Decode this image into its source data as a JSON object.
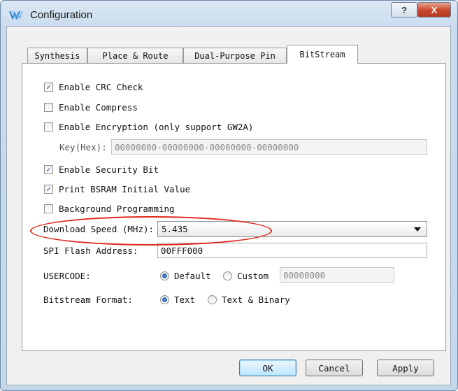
{
  "window": {
    "title": "Configuration",
    "help_label": "?",
    "close_label": "X"
  },
  "tabs": [
    {
      "label": "Synthesis",
      "active": false
    },
    {
      "label": "Place & Route",
      "active": false
    },
    {
      "label": "Dual-Purpose Pin",
      "active": false
    },
    {
      "label": "BitStream",
      "active": true
    }
  ],
  "options": {
    "crc": {
      "label": "Enable CRC Check",
      "checked": true
    },
    "compress": {
      "label": "Enable Compress",
      "checked": false
    },
    "encryption": {
      "label": "Enable Encryption (only support GW2A)",
      "checked": false
    },
    "key": {
      "label": "Key(Hex):",
      "value": "00000000-00000000-00000000-00000000"
    },
    "security": {
      "label": "Enable Security Bit",
      "checked": true
    },
    "bsram": {
      "label": "Print BSRAM Initial Value",
      "checked": true
    },
    "background": {
      "label": "Background Programming",
      "checked": false
    }
  },
  "download_speed": {
    "label": "Download Speed (MHz):",
    "value": "5.435"
  },
  "spi_flash": {
    "label": "SPI Flash Address:",
    "value": "00FFF000"
  },
  "usercode": {
    "label": "USERCODE:",
    "default_label": "Default",
    "custom_label": "Custom",
    "custom_value": "00000000",
    "selected": "Default"
  },
  "bitstream_format": {
    "label": "Bitstream Format:",
    "text_label": "Text",
    "binary_label": "Text & Binary",
    "selected": "Text"
  },
  "buttons": {
    "ok": "OK",
    "cancel": "Cancel",
    "apply": "Apply"
  },
  "colors": {
    "highlight_ellipse": "#e0251b",
    "accent": "#3c7fb1"
  }
}
